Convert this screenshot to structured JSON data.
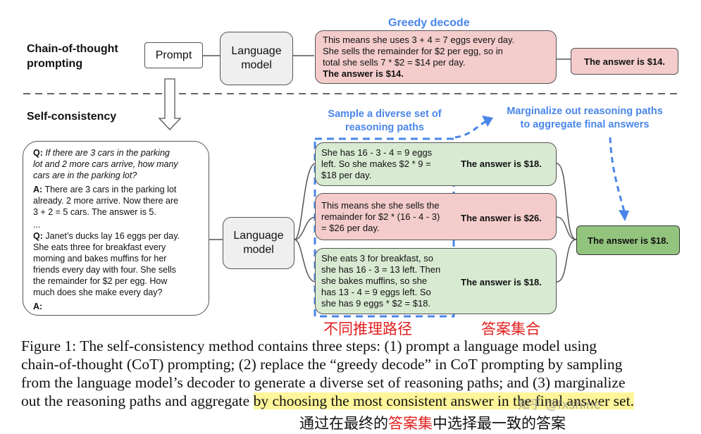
{
  "cot": {
    "label_line1": "Chain-of-thought",
    "label_line2": "prompting",
    "prompt_box": "Prompt",
    "lm_line1": "Language",
    "lm_line2": "model",
    "greedy_title": "Greedy decode",
    "greedy_line1": "This means she uses 3 + 4 = 7 eggs every day.",
    "greedy_line2": "She sells the remainder for $2 per egg, so in",
    "greedy_line3": "total she sells 7 * $2 = $14 per day.",
    "greedy_line4": "The answer is $14.",
    "answer": "The answer is $14."
  },
  "sc": {
    "label": "Self-consistency",
    "prompt": {
      "q1_prefix": "Q:",
      "q1_l1": " If there are 3 cars in the parking",
      "q1_l2": "lot and 2 more cars arrive, how many",
      "q1_l3": "cars are in the parking lot?",
      "a1_prefix": "A:",
      "a1_l1": " There are 3 cars in the parking lot",
      "a1_l2": "already. 2 more arrive. Now there are",
      "a1_l3": "3 + 2 = 5 cars. The answer is 5.",
      "ellipsis": "...",
      "q2_prefix": "Q:",
      "q2_l1": " Janet’s ducks lay 16 eggs per day.",
      "q2_l2": "She eats three for breakfast every",
      "q2_l3": "morning and bakes muffins for her",
      "q2_l4": "friends every day with four. She sells",
      "q2_l5": "the remainder for $2 per egg. How",
      "q2_l6": "much does she make every day?",
      "a2_prefix": "A:"
    },
    "lm_line1": "Language",
    "lm_line2": "model",
    "sample_title_l1": "Sample a diverse set of",
    "sample_title_l2": "reasoning paths",
    "marg_title_l1": "Marginalize out reasoning paths",
    "marg_title_l2": "to aggregate final answers",
    "paths": [
      {
        "lines": [
          "She has 16 - 3 - 4 = 9 eggs",
          "left. So she makes $2 * 9 =",
          "$18 per day."
        ],
        "answer": "The answer is $18.",
        "color": "green"
      },
      {
        "lines": [
          "This means she she sells the",
          "remainder for $2 * (16 - 4 - 3)",
          "= $26 per day."
        ],
        "answer": "The answer is $26.",
        "color": "pink"
      },
      {
        "lines": [
          "She eats 3 for breakfast, so",
          "she has 16 - 3 = 13 left. Then",
          "she bakes muffins, so she",
          "has 13 - 4 = 9 eggs left. So",
          "she has 9 eggs * $2 = $18."
        ],
        "answer": "The answer is $18.",
        "color": "green"
      }
    ],
    "final_answer": "The answer is $18."
  },
  "annotations": {
    "paths_cn": "不同推理路径",
    "answers_cn": "答案集合",
    "bottom_pre": "通过在最终的",
    "bottom_red": "答案集",
    "bottom_post": "中选择最一致的答案",
    "watermark": "知乎 @fxshine"
  },
  "caption": {
    "l1": "Figure 1: The self-consistency method contains three steps: (1) prompt a language model using",
    "l2": "chain-of-thought (CoT) prompting; (2) replace the “greedy decode” in CoT prompting by sampling",
    "l3": "from the language model’s decoder to generate a diverse set of reasoning paths; and (3) marginalize",
    "l4_pre": "out the reasoning paths and aggregate ",
    "l4_hl": "by choosing the most consistent answer in the final answer set."
  },
  "colors": {
    "blue_accent": "#4a86e8",
    "pink_box": "#f4cccc",
    "green_box": "#d9ead3",
    "final_green": "#93c47d",
    "red_annotation": "#e02020",
    "highlight": "#fff59a"
  }
}
